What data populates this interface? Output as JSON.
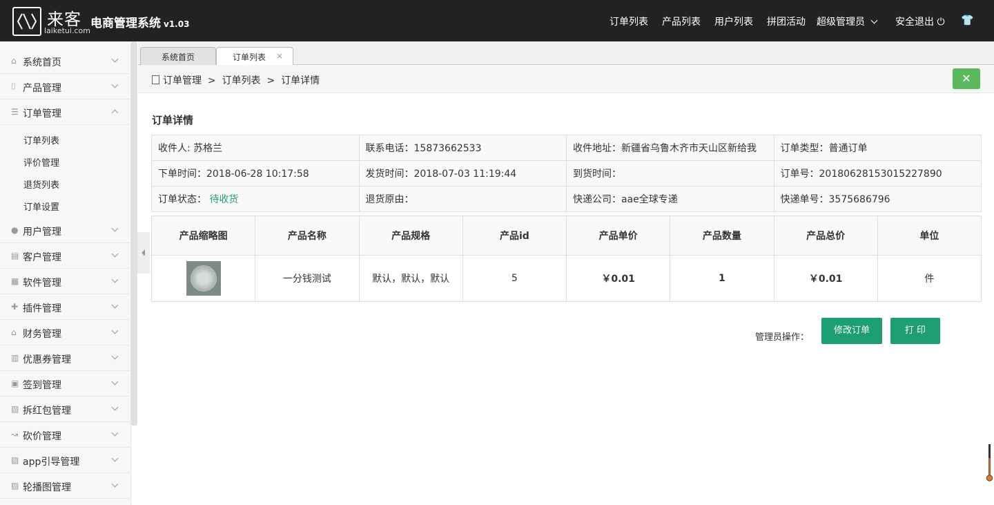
{
  "brand": {
    "name_cn": "来客",
    "name_en": "laiketui.com",
    "system_title": "电商管理系统",
    "version": "v1.03"
  },
  "topnav": {
    "items": [
      "订单列表",
      "产品列表",
      "用户列表",
      "拼团活动"
    ],
    "admin": "超级管理员",
    "logout": "安全退出"
  },
  "sidebar": {
    "items": [
      {
        "label": "系统首页",
        "icon": "home-icon"
      },
      {
        "label": "产品管理",
        "icon": "bag-icon"
      },
      {
        "label": "订单管理",
        "icon": "list-icon"
      },
      {
        "label": "用户管理",
        "icon": "user-icon"
      },
      {
        "label": "客户管理",
        "icon": "doc-icon"
      },
      {
        "label": "软件管理",
        "icon": "grid-icon"
      },
      {
        "label": "插件管理",
        "icon": "puzzle-icon"
      },
      {
        "label": "财务管理",
        "icon": "bank-icon"
      },
      {
        "label": "优惠券管理",
        "icon": "book-icon"
      },
      {
        "label": "签到管理",
        "icon": "clipboard-icon"
      },
      {
        "label": "拆红包管理",
        "icon": "gift-icon"
      },
      {
        "label": "砍价管理",
        "icon": "trend-icon"
      },
      {
        "label": "app引导管理",
        "icon": "image-icon"
      },
      {
        "label": "轮播图管理",
        "icon": "image-icon"
      }
    ],
    "sub_items": [
      "订单列表",
      "评价管理",
      "退货列表",
      "订单设置"
    ]
  },
  "tabs": [
    {
      "label": "系统首页"
    },
    {
      "label": "订单列表",
      "close": "×"
    }
  ],
  "breadcrumb": {
    "root": "订单管理",
    "sep1": ">",
    "mid": "订单列表",
    "sep2": ">",
    "current": "订单详情"
  },
  "close_button": "✕",
  "section_title": "订单详情",
  "info": {
    "row1": [
      "收件人: 苏格兰",
      "联系电话：15873662533",
      "收件地址：新疆省乌鲁木齐市天山区新给我",
      "订单类型：普通订单"
    ],
    "row2": [
      "下单时间：2018-06-28 10:17:58",
      "发货时间：2018-07-03 11:19:44",
      "到货时间：",
      "订单号：20180628153015227890"
    ],
    "status_label": "订单状态：",
    "status_value": "待收货",
    "row3": [
      "退货原由：",
      "快递公司：aae全球专递",
      "快递单号：3575686796"
    ]
  },
  "products": {
    "headers": [
      "产品缩略图",
      "产品名称",
      "产品规格",
      "产品id",
      "产品单价",
      "产品数量",
      "产品总价",
      "单位"
    ],
    "rows": [
      {
        "name": "一分钱测试",
        "spec": "默认，默认，默认",
        "id": "5",
        "unit_price": "￥0.01",
        "qty": "1",
        "total": "￥0.01",
        "unit": "件"
      }
    ]
  },
  "ops": {
    "label": "管理员操作：",
    "edit": "修改订单",
    "print": "打 印"
  },
  "colors": {
    "accent": "#1e9e74",
    "close": "#5cb85c",
    "topbar": "#222222"
  }
}
